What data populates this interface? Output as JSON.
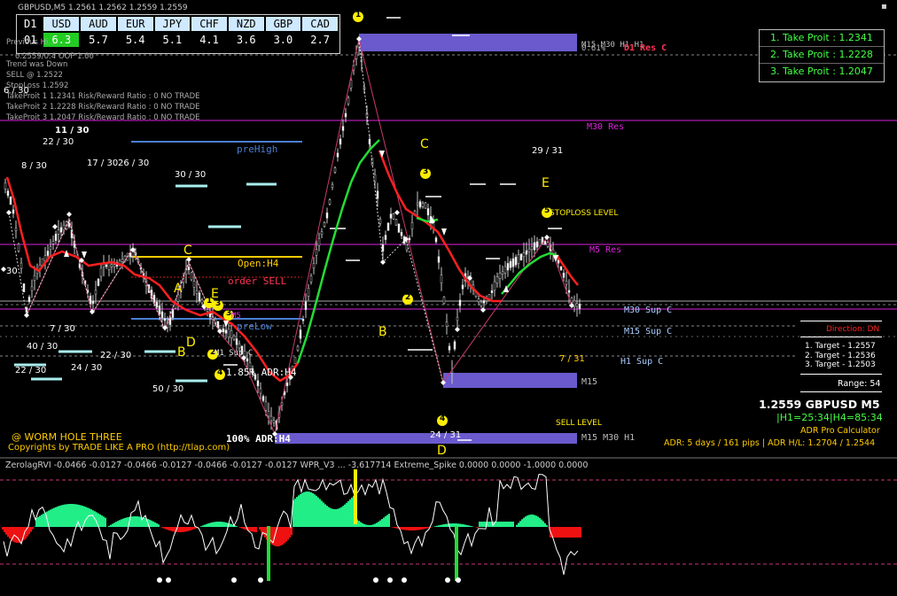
{
  "window": {
    "title": "GBPUSD,M5  1.2561 1.2562 1.2559 1.2559"
  },
  "strength_table": {
    "headers": [
      "D1",
      "USD",
      "AUD",
      "EUR",
      "JPY",
      "CHF",
      "NZD",
      "GBP",
      "CAD"
    ],
    "row_label": "01",
    "values": [
      "6.3",
      "5.7",
      "5.4",
      "5.1",
      "4.1",
      "3.6",
      "3.0",
      "2.7"
    ]
  },
  "info_block": {
    "lines": [
      "Previous Hi...",
      "Trend was Down",
      "SELL @ 1.2522",
      "StopLoss 1.2592",
      "TakeProit 1 1.2341 Risk/Reward Ratio : 0 NO TRADE",
      "TakeProit 2 1.2228 Risk/Reward Ratio : 0 NO TRADE",
      "TakeProit 3 1.2047 Risk/Reward Ratio : 0 NO TRADE"
    ],
    "overlap_line": "0.2559/0.4 OOP 1.00"
  },
  "take_profit_box": {
    "items": [
      "1. Take Proit : 1.2341",
      "2. Take Proit : 1.2228",
      "3. Take Proit : 1.2047"
    ]
  },
  "levels": {
    "d1_res": "D1 Res C",
    "h1_label": "M15 M30 H1 H1",
    "pct_top": "0.61%",
    "m30_res": "M30 Res",
    "m5_res": "M5 Res",
    "m30_sup": "M30 Sup C",
    "m15_sup": "M15 Sup C",
    "h1_sup": "H1 Sup C",
    "m15": "M15",
    "bottom_zone": "M15 M30 H1",
    "prehigh": "preHigh",
    "prelow": "preLow",
    "open_h4": "Open:H4",
    "order_sell": "order SELL",
    "adr_h4_1": "1.85% ADR:H4",
    "adr_h4_2": "100% ADR:H4",
    "m1_sup": "M1 Sup C",
    "m5_small": "M5",
    "stoploss_level": "STOPLOSS LEVEL",
    "sell_level": "SELL LEVEL"
  },
  "wave_labels": {
    "c1": "C",
    "e1": "E",
    "a1": "A",
    "d1": "D",
    "b1": "B",
    "e2": "E",
    "c2": "C",
    "b2": "B",
    "e3": "E",
    "d2": "D",
    "n1": "1",
    "n2": "2",
    "n3": "3",
    "n4": "4",
    "n5": "5",
    "n3b": "3",
    "n4b": "4",
    "n1b": "1",
    "n2b": "2",
    "n3c": "3"
  },
  "day_labels": [
    "6 / 30",
    "11 / 30",
    "22 / 30",
    "8 / 30",
    "17 / 30",
    "26 / 30",
    "30 / 30",
    "7 / 30",
    "40 / 30",
    "22 / 30",
    "24 / 30",
    "22 / 30",
    "50 / 30",
    "29 / 31",
    "7 / 31",
    "24 / 31",
    "30"
  ],
  "right_panel": {
    "direction": "Direction: DN",
    "targets": [
      "1. Target - 1.2557",
      "2. Target - 1.2536",
      "3. Target - 1.2503"
    ],
    "range": "Range: 54",
    "price": "1.2559 GBPUSD M5",
    "hours": "|H1=25:34|H4=85:34",
    "calc": "ADR Pro Calculator",
    "adr": "ADR: 5 days / 161 pips | ADR H/L: 1.2704 / 1.2544"
  },
  "branding": {
    "name": "@ WORM HOLE THREE",
    "copyright": "Copyrights by TRADE LIKE A PRO (http://tlap.com)"
  },
  "indicator": {
    "title": "ZerolagRVI -0.0466 -0.0127 -0.0466 -0.0127 -0.0466 -0.0127 -0.0127   WPR_V3 ...  -3.617714 Extreme_Spike 0.0000 0.0000 -1.0000 0.0000"
  },
  "colors": {
    "background": "#000000",
    "candle": "#c8c8c8",
    "ma_red": "#ff2020",
    "ma_green": "#22dd33",
    "zone": "#6a5acd",
    "magenta": "#dd22dd",
    "yellow": "#ffee00",
    "green_text": "#44ff44",
    "orange": "#ffcc00"
  },
  "chart_data": {
    "type": "line",
    "title": "",
    "series": []
  }
}
